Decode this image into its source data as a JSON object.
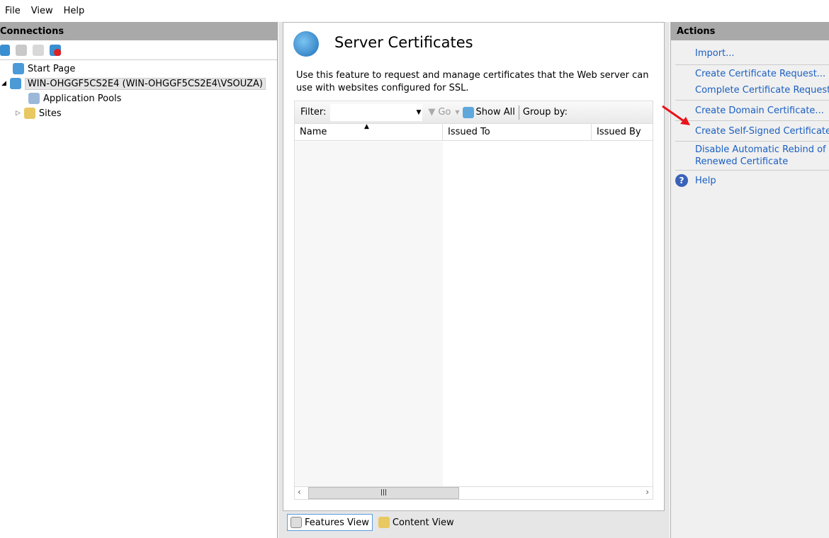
{
  "menu": [
    "File",
    "View",
    "Help"
  ],
  "connections": {
    "title": "Connections",
    "tree": [
      "Start Page",
      "WIN-OHGGF5CS2E4 (WIN-OHGGF5CS2E4\\VSOUZA)",
      "Application Pools",
      "Sites"
    ]
  },
  "main": {
    "title": "Server Certificates",
    "description": "Use this feature to request and manage certificates that the Web server can use with websites configured for SSL.",
    "filter_label": "Filter:",
    "filter_value": "",
    "go_label": "Go",
    "show_all_label": "Show All",
    "group_by_label": "Group by:",
    "columns": [
      "Name",
      "Issued To",
      "Issued By"
    ]
  },
  "tabs": [
    "Features View",
    "Content View"
  ],
  "actions": {
    "title": "Actions",
    "items": [
      "Import...",
      "Create Certificate Request...",
      "Complete Certificate Request...",
      "Create Domain Certificate...",
      "Create Self-Signed Certificate...",
      "Disable Automatic Rebind of Renewed Certificate",
      "Help"
    ]
  },
  "colors": {
    "link": "#1a5fc2",
    "arrow": "#e8141a"
  }
}
